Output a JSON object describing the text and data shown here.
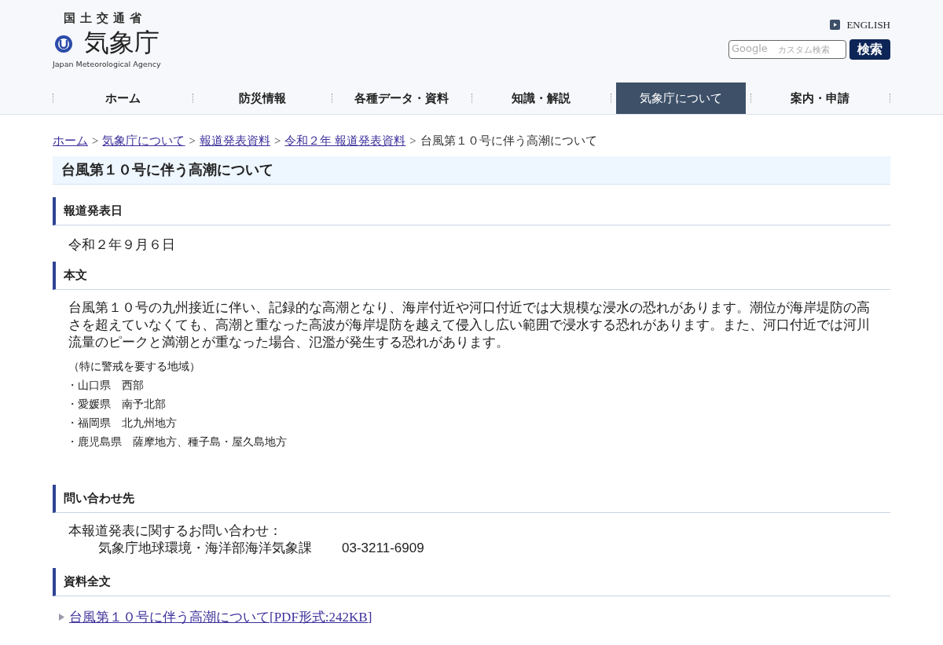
{
  "header": {
    "ministry": "国土交通省",
    "agency": "気象庁",
    "agency_en": "Japan Meteorological Agency",
    "english_link": "ENGLISH",
    "search": {
      "placeholder": "カスタム検索",
      "brand": "Google"
    },
    "search_button": "検索"
  },
  "nav": [
    {
      "label": "ホーム",
      "selected": false
    },
    {
      "label": "防災情報",
      "selected": false
    },
    {
      "label": "各種データ・資料",
      "selected": false
    },
    {
      "label": "知識・解説",
      "selected": false
    },
    {
      "label": "気象庁について",
      "selected": true
    },
    {
      "label": "案内・申請",
      "selected": false
    }
  ],
  "breadcrumb": [
    {
      "label": "ホーム",
      "kind": "link"
    },
    {
      "label": "気象庁について",
      "kind": "link"
    },
    {
      "label": "報道発表資料",
      "kind": "link"
    },
    {
      "label": "令和２年 報道発表資料",
      "kind": "link"
    },
    {
      "label": "台風第１０号に伴う高潮について",
      "kind": "current"
    }
  ],
  "separator": ">",
  "page_title": "台風第１０号に伴う高潮について",
  "sections": [
    {
      "heading": "報道発表日",
      "kind": "date",
      "text": "令和２年９月６日"
    },
    {
      "heading": "本文",
      "kind": "body",
      "text": "台風第１０号の九州接近に伴い、記録的な高潮となり、海岸付近や河口付近では大規模な浸水の恐れがあります。潮位が海岸堤防の高さを超えていなくても、高潮と重なった高波が海岸堤防を越えて侵入し広い範囲で浸水する恐れがあります。また、河口付近では河川流量のピークと満潮とが重なった場合、氾濫が発生する恐れがあります。",
      "note": "（特に警戒を要する地域）",
      "items": [
        "・山口県　西部",
        "・愛媛県　南予北部",
        "・福岡県　北九州地方",
        "・鹿児島県　薩摩地方、種子島・屋久島地方"
      ]
    },
    {
      "heading": "問い合わせ先",
      "kind": "contact",
      "lines": [
        "本報道発表に関するお問い合わせ：",
        "気象庁地球環境・海洋部海洋気象課"
      ],
      "phone": "03-3211-6909"
    },
    {
      "heading": "資料全文",
      "kind": "files",
      "links": [
        "台風第１０号に伴う高潮について[PDF形式:242KB]"
      ]
    }
  ]
}
